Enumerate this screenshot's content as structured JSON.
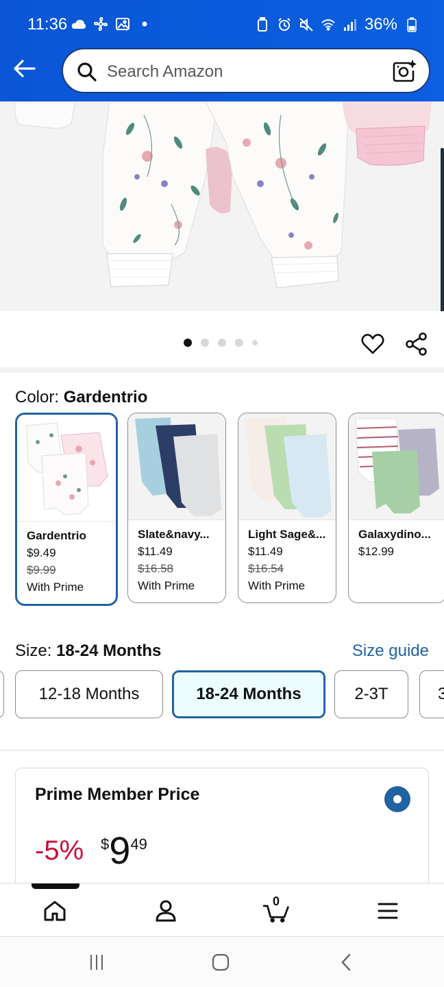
{
  "status": {
    "time": "11:36",
    "battery": "36%"
  },
  "search": {
    "placeholder": "Search Amazon"
  },
  "gallery": {
    "dot_count": 5,
    "active_dot": 0
  },
  "color": {
    "label": "Color: ",
    "selected": "Gardentrio",
    "swatches": [
      {
        "name": "Gardentrio",
        "price": "$9.49",
        "list_price": "$9.99",
        "badge": "With Prime"
      },
      {
        "name": "Slate&navy...",
        "price": "$11.49",
        "list_price": "$16.58",
        "badge": "With Prime"
      },
      {
        "name": "Light Sage&...",
        "price": "$11.49",
        "list_price": "$16.54",
        "badge": "With Prime"
      },
      {
        "name": "Galaxydino...",
        "price": "$12.99",
        "list_price": "",
        "badge": ""
      }
    ]
  },
  "size": {
    "label": "Size: ",
    "selected": "18-24 Months",
    "guide": "Size guide",
    "options": [
      "12-18 Months",
      "18-24 Months",
      "2-3T",
      "3"
    ]
  },
  "price_card": {
    "title": "Prime Member Price",
    "discount": "-5%",
    "currency": "$",
    "whole": "9",
    "fraction": "49"
  },
  "nav": {
    "cart_count": "0"
  },
  "colors": {
    "header_blue": "#0a56d6",
    "link_blue": "#2162a1",
    "discount_red": "#cc0c39"
  }
}
